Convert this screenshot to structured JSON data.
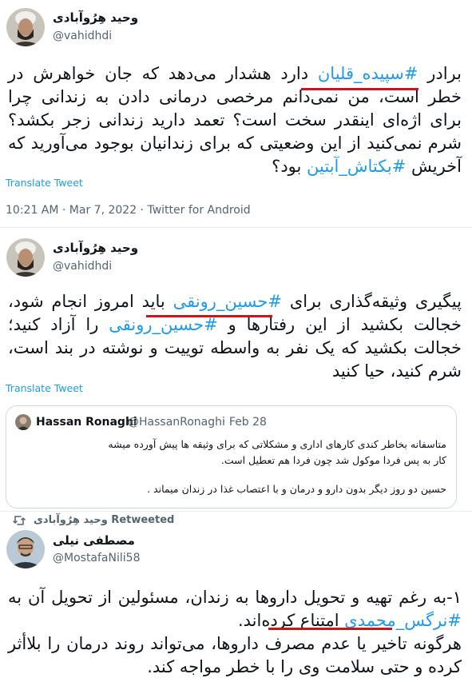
{
  "tweet1": {
    "display_name": "وحید هِرُوآبادی",
    "handle": "@vahidhdi",
    "text_before_tag1": "برادر ",
    "hashtag1": "#سپیده_قلیان",
    "text_middle": " دارد هشدار می‌دهد که جان خواهرش در خطر است، من نمی‌دانم مرخصی درمانی دادن به زندانی چرا برای اژه‌ای اینقدر سخت است؟ تعمد دارید زندانی زجر بکشد؟ شرم نمی‌کنید از این وضعیتی که برای زندانیان بوجود می‌آورید که آخریش ",
    "hashtag2": "#بکتاش_آبتین",
    "text_end": " بود؟",
    "translate": "Translate Tweet",
    "meta": "10:21 AM · Mar 7, 2022 · Twitter for Android"
  },
  "tweet2": {
    "display_name": "وحید هِرُوآبادی",
    "handle": "@vahidhdi",
    "text_before_tag1": "پیگیری وثیقه‌گذاری برای ",
    "hashtag1": "#حسین_رونقی",
    "text_middle": " باید امروز انجام شود، خجالت بکشید از این رفتارها و ",
    "hashtag2": "#حسین_رونقی",
    "text_end": " را آزاد کنید؛ خجالت بکشید که یک نفر به واسطه توییت و نوشته در بند است، شرم کنید، حیا کنید",
    "translate": "Translate Tweet",
    "quote": {
      "name": "Hassan Ronaghi",
      "handle": "@HassanRonaghi",
      "date": "· Feb 28",
      "line1": "متاسفانه بخاطر کندی کارهای اداری و مشکلاتی که برای وثیقه ها پیش آورده میشه",
      "line2": "کار به پس فردا موکول شد چون فردا هم تعطیل است.",
      "line3": "حسین دو روز دیگر بدون دارو و درمان و با اعتصاب غذا در زندان میماند ."
    }
  },
  "tweet3": {
    "retweeted_label": "وحید هِرُوآبادی Retweeted",
    "display_name": "مصطفی نیلی",
    "handle": "@MostafaNili58",
    "text_before_tag": "۱-به رغم تهیه و تحویل داروها به زندان، مسئولین از تحویل آن به ",
    "hashtag": "#نرگس_محمدی",
    "text_after_tag": " امتناع کرده‌اند.",
    "paragraph2": "هرگونه تاخیر یا عدم مصرف داروها، می‌تواند روند درمان را بلاأثر کرده و حتی سلامت وی را با خطر مواجه کند."
  },
  "colors": {
    "link": "#1d9bf0",
    "underline": "#d0121b",
    "secondary": "#536471"
  }
}
